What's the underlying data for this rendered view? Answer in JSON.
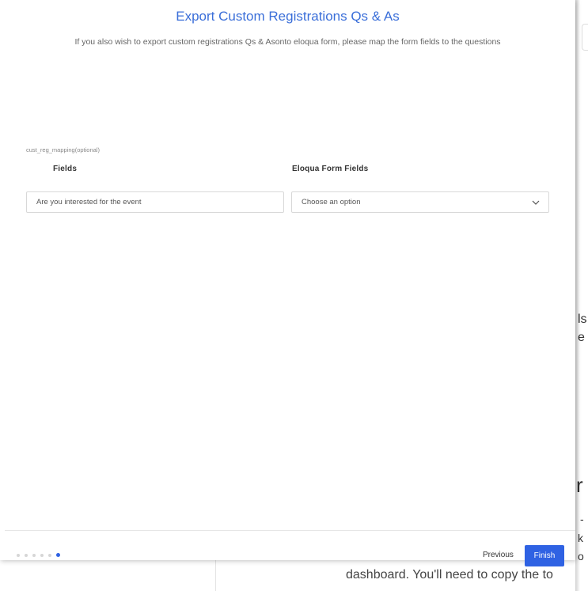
{
  "modal": {
    "title": "Export Custom Registrations Qs & As",
    "subtitle": "If you also wish to export custom registrations Qs & Asonto eloqua form, please map the form fields to the questions",
    "mapping_label": "cust_reg_mapping(optional)",
    "columns": {
      "fields": "Fields",
      "eloqua": "Eloqua Form Fields"
    },
    "row": {
      "field_value": "Are you interested for the event",
      "select_value": "Choose an option"
    },
    "footer": {
      "steps_total": 6,
      "steps_active": 6,
      "previous_label": "Previous",
      "finish_label": "Finish"
    }
  },
  "background": {
    "frag1": "ls",
    "frag2": "e",
    "frag3": "r",
    "frag4": "-",
    "frag5": "k",
    "frag6": "o",
    "frag7": "dashboard. You'll need to copy the to"
  },
  "colors": {
    "accent": "#2f62e3",
    "title": "#3b6fd9"
  }
}
